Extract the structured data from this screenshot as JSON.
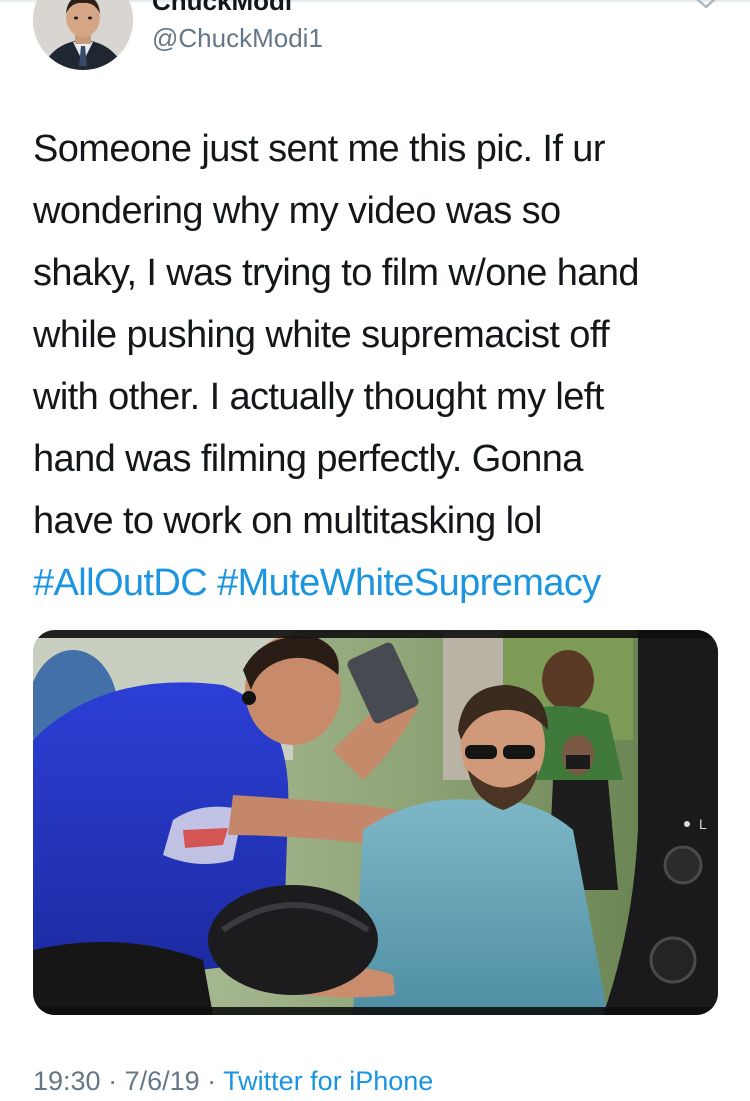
{
  "tweet": {
    "author": {
      "display_name": "ChuckModi",
      "handle": "@ChuckModi1",
      "avatar": "profile-photo"
    },
    "menu_icon": "chevron-down-icon",
    "text_lines": [
      "Someone just sent me this pic. If ur",
      "wondering why my video was so",
      "shaky, I was trying to film w/one hand",
      "while pushing white supremacist off",
      "with other. I actually thought my left",
      "hand was filming perfectly. Gonna",
      "have to work on multitasking lol"
    ],
    "hashtags": [
      "#AllOutDC",
      "#MuteWhiteSupremacy"
    ],
    "media": {
      "type": "photo",
      "camera_labels": [
        "L"
      ]
    },
    "meta": {
      "time": "19:30",
      "sep1": " · ",
      "date": "7/6/19",
      "sep2": " · ",
      "source": "Twitter for iPhone"
    }
  },
  "colors": {
    "link": "#1b95e0",
    "text": "#14171a",
    "secondary": "#657786"
  }
}
